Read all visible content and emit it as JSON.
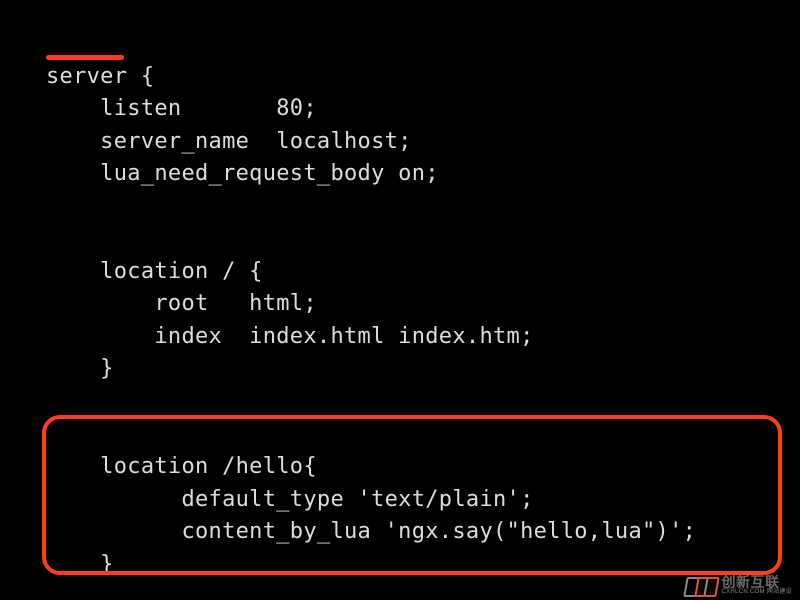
{
  "code": {
    "lines": [
      "server {",
      "    listen       80;",
      "    server_name  localhost;",
      "    lua_need_request_body on;",
      "",
      "",
      "    location / {",
      "        root   html;",
      "        index  index.html index.htm;",
      "    }",
      "",
      "",
      "    location /hello{",
      "          default_type 'text/plain';",
      "          content_by_lua 'ngx.say(\"hello,lua\")';",
      "    }"
    ]
  },
  "watermark": {
    "main": "创新互联",
    "sub": "CXHLCN.COM 网站建设"
  }
}
